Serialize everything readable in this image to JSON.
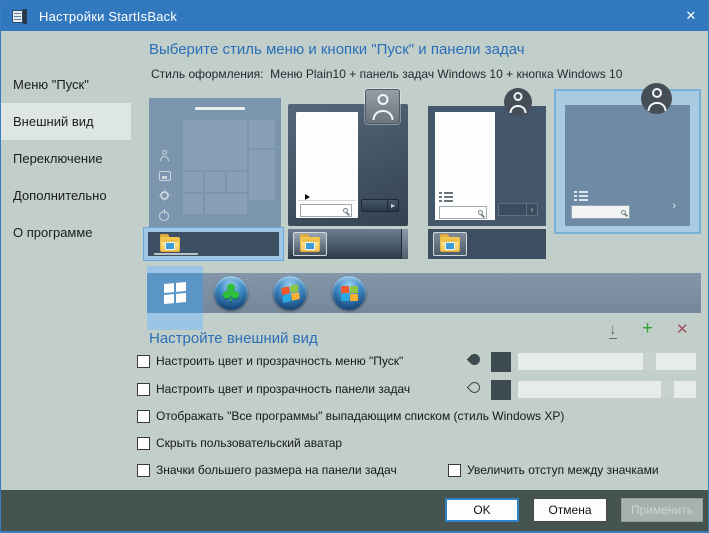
{
  "window": {
    "title": "Настройки StartIsBack"
  },
  "icons": {
    "close": "✕",
    "download": "↓",
    "add": "+",
    "remove": "✕",
    "clover": "♣",
    "chevron_right": "›",
    "shutdown_arrow": "▸"
  },
  "colors": {
    "titlebar": "#3278be",
    "heading_blue": "#2a6fb8",
    "selection_blue": "#9cc4e4",
    "swatch_dark": "#3d4b51",
    "footer_bg": "#46544f",
    "ok_border": "#2f83c6"
  },
  "sidebar": {
    "items": [
      {
        "label": "Меню \"Пуск\"",
        "selected": false
      },
      {
        "label": "Внешний вид",
        "selected": true
      },
      {
        "label": "Переключение",
        "selected": false
      },
      {
        "label": "Дополнительно",
        "selected": false
      },
      {
        "label": "О программе",
        "selected": false
      }
    ]
  },
  "main": {
    "heading": "Выберите стиль меню и кнопки \"Пуск\" и панели задач",
    "style_label": "Стиль оформления:",
    "style_value": "Меню Plain10 + панель задач Windows 10 + кнопка Windows 10",
    "menu_styles": [
      {
        "name": "windows10-menu",
        "selected": false
      },
      {
        "name": "windows7-aero-menu",
        "selected": false
      },
      {
        "name": "windows8-menu",
        "selected": false
      },
      {
        "name": "plain10-menu",
        "selected": true
      }
    ],
    "taskbar_styles": [
      {
        "name": "windows10-taskbar",
        "selected": true
      },
      {
        "name": "windows7-aero-taskbar",
        "selected": false
      },
      {
        "name": "windows8-taskbar",
        "selected": false
      }
    ],
    "start_buttons": [
      {
        "name": "windows10-flag",
        "selected": true
      },
      {
        "name": "clover-orb",
        "selected": false
      },
      {
        "name": "windows7-orb",
        "selected": false
      },
      {
        "name": "windows8-orb",
        "selected": false
      }
    ]
  },
  "appearance": {
    "heading": "Настройте внешний вид",
    "checkboxes": [
      {
        "label": "Настроить цвет и прозрачность меню \"Пуск\"",
        "checked": false,
        "slider_percent": 74
      },
      {
        "label": "Настроить цвет и прозрачность панели задач",
        "checked": false,
        "slider_percent": 84
      },
      {
        "label": "Отображать \"Все программы\" выпадающим списком (стиль Windows XP)",
        "checked": false
      },
      {
        "label": "Скрыть пользовательский аватар",
        "checked": false
      },
      {
        "label": "Значки большего размера на панели задач",
        "checked": false
      },
      {
        "label": "Увеличить отступ между значками",
        "checked": false
      }
    ]
  },
  "footer": {
    "ok": "OK",
    "cancel": "Отмена",
    "apply": "Применить",
    "apply_disabled": true
  }
}
